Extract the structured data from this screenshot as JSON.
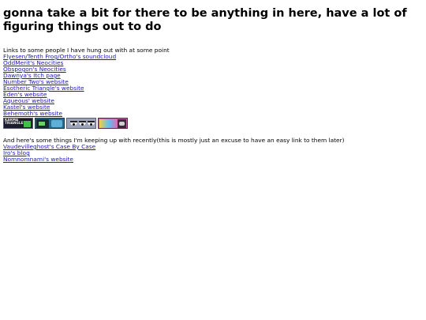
{
  "heading": "gonna take a bit for there to be anything in here, have a lot of figuring things out to do",
  "friends_section": {
    "intro": "Links to some people I have hung out with at some point",
    "links": [
      "Flyesen/Tenth Frog/Ortho's soundcloud",
      "OddMerit's Neocities",
      "Obspogon's Neocities",
      "Dawnya's Itch page",
      "Number Two's website",
      "Esotheric Triangle's website",
      "Eden's website",
      "Aqueous' website",
      "Kastel's website",
      "Behemoth's website"
    ],
    "buttons": [
      {
        "text": "KARMA TRIANGLES",
        "icon": "karma-triangles-88x31-button"
      },
      {
        "text": "",
        "icon": "pixel-art-88x31-button"
      },
      {
        "text": "",
        "icon": "eyes-88x31-button"
      },
      {
        "text": "",
        "icon": "colorful-88x31-button"
      }
    ]
  },
  "recent_section": {
    "intro": "And here's some things I'm keeping up with recently(this is mostly just an excuse to have an easy link to them later)",
    "links": [
      "Vaudevilleghost's Case By Case",
      "Iro's blog",
      "Nomnomnami's website"
    ]
  },
  "colors": {
    "link": "#1a1ab8",
    "text": "#000000",
    "background": "#ffffff"
  }
}
